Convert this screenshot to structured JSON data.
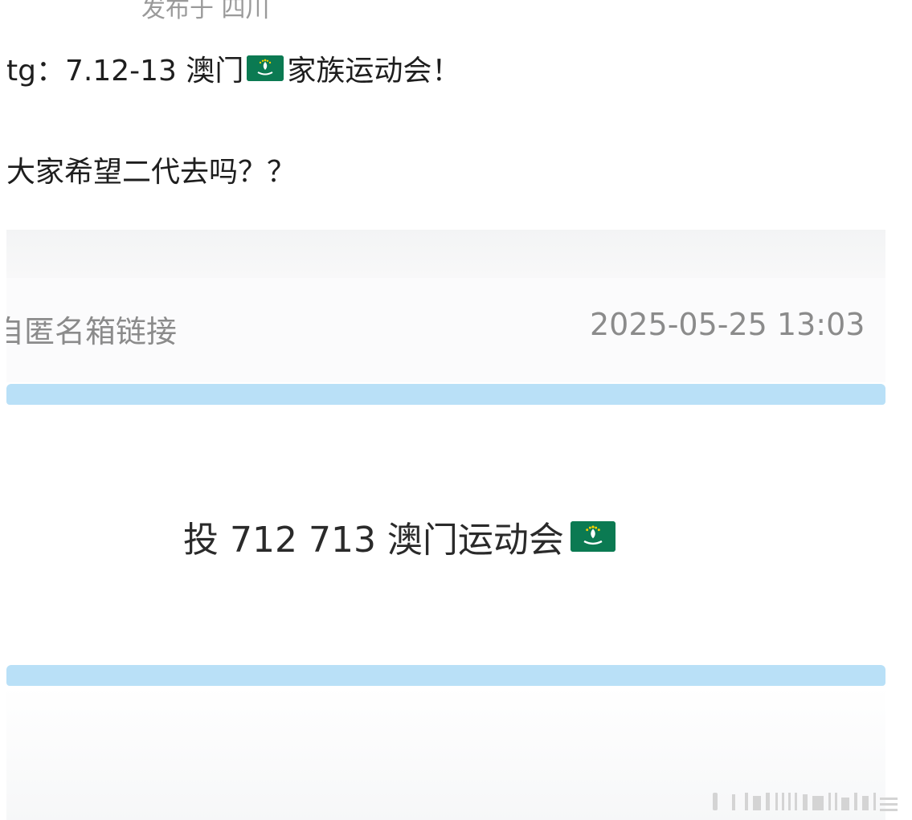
{
  "post": {
    "location": "发布于 四川",
    "line1_before_flag": "tg：7.12-13 澳门",
    "line1_after_flag": "家族运动会！",
    "line2": "大家希望二代去吗？？"
  },
  "screenshot": {
    "source_label": "自匿名箱链接",
    "timestamp": "2025-05-25 13:03",
    "message_text": "投 712 713 澳门运动会"
  },
  "icons": {
    "flag": "macau-flag-icon",
    "watermark": "weibo-watermark-icon"
  },
  "colors": {
    "bar": "#b9e0f7",
    "flag_green": "#0b7a52",
    "meta_text": "#8b8b8b"
  }
}
